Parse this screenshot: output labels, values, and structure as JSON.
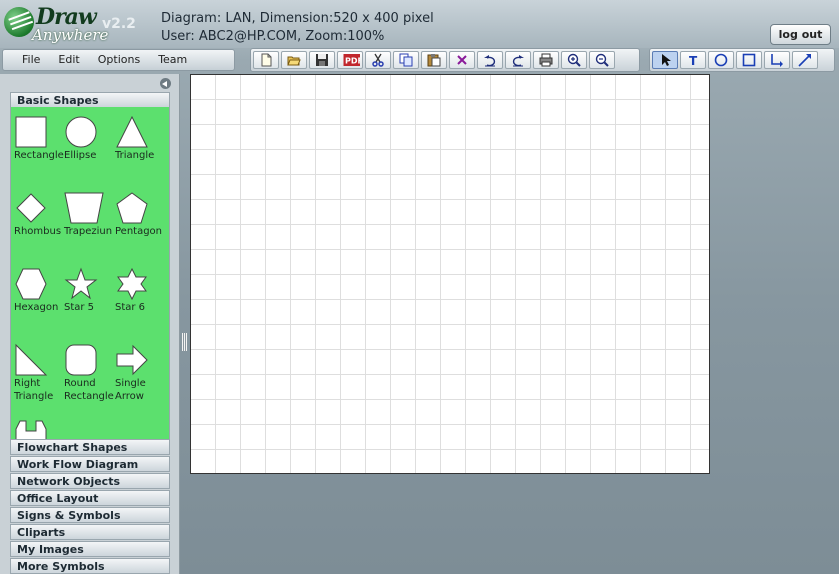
{
  "app": {
    "logo_draw": "Draw",
    "logo_anywhere": "Anywhere",
    "version": "v2.2",
    "info_line1": "Diagram: LAN, Dimension:520 x 400 pixel",
    "info_line2": "User: ABC2@HP.COM, Zoom:100%",
    "logout_label": "log out"
  },
  "menu": [
    "File",
    "Edit",
    "Options",
    "Team"
  ],
  "toolbar": {
    "file_tools": [
      "new-icon",
      "open-icon",
      "save-icon",
      "pdf-icon",
      "cut-icon",
      "copy-icon",
      "paste-icon",
      "delete-icon",
      "undo-icon",
      "redo-icon",
      "print-icon",
      "zoom-in-icon",
      "zoom-out-icon"
    ],
    "draw_tools": [
      "pointer-icon",
      "text-icon",
      "ellipse-tool-icon",
      "rectangle-tool-icon",
      "connector-icon",
      "line-icon"
    ],
    "active_tool": "pointer-icon",
    "pdf_text": "PDF",
    "text_tool_glyph": "T"
  },
  "panel": {
    "active_category": "Basic Shapes",
    "shapes": [
      {
        "name": "rectangle",
        "label": "Rectangle"
      },
      {
        "name": "ellipse",
        "label": "Ellipse"
      },
      {
        "name": "triangle",
        "label": "Triangle"
      },
      {
        "name": "rhombus",
        "label": "Rhombus"
      },
      {
        "name": "trapezium",
        "label": "Trapeziun"
      },
      {
        "name": "pentagon",
        "label": "Pentagon"
      },
      {
        "name": "hexagon",
        "label": "Hexagon"
      },
      {
        "name": "star-5",
        "label": "Star 5"
      },
      {
        "name": "star-6",
        "label": "Star 6"
      },
      {
        "name": "right-triangle",
        "label": "Right Triangle"
      },
      {
        "name": "round-rectangle",
        "label": "Round Rectangle"
      },
      {
        "name": "single-arrow",
        "label": "Single Arrow"
      }
    ],
    "categories": [
      "Flowchart Shapes",
      "Work Flow Diagram",
      "Network Objects",
      "Office Layout",
      "Signs & Symbols",
      "Cliparts",
      "My Images",
      "More Symbols"
    ]
  },
  "colors": {
    "shape_panel_bg": "#5ce06e",
    "active_tool_bg": "#bcd2f0"
  }
}
